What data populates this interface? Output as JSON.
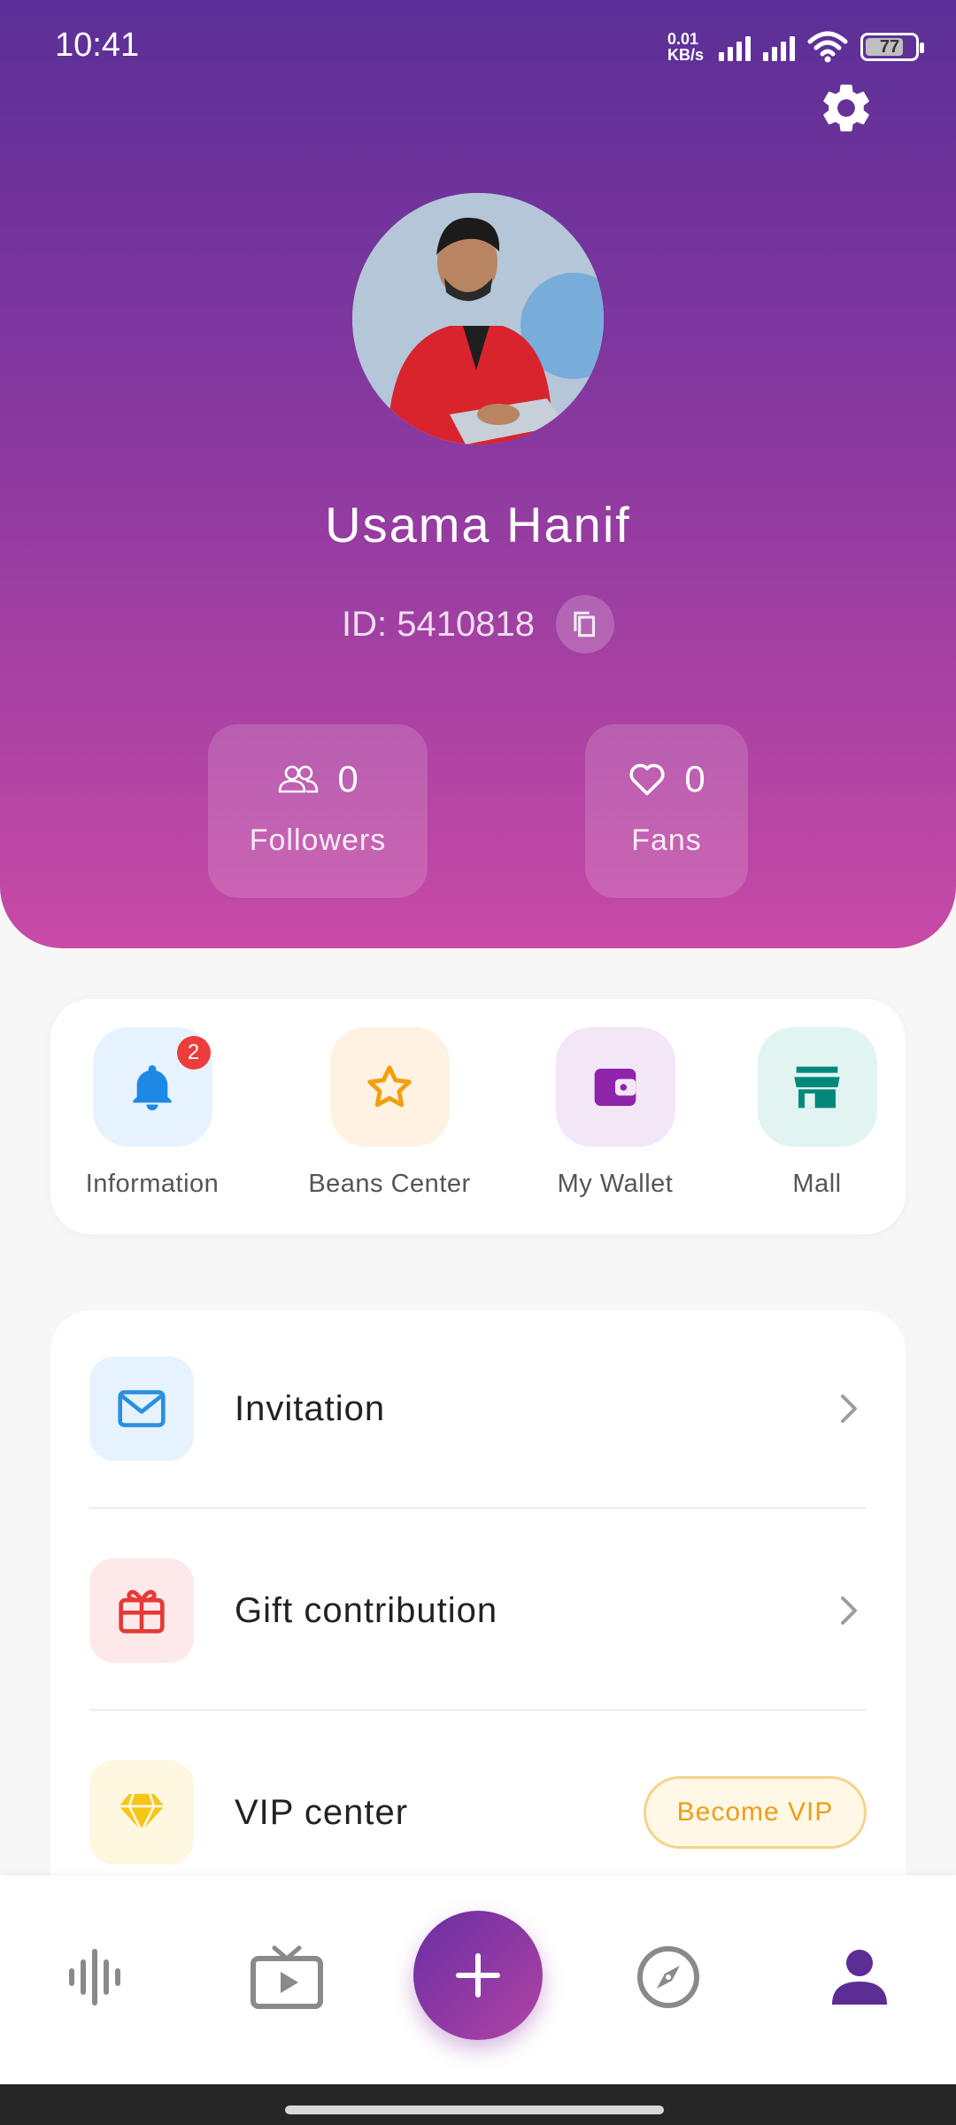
{
  "status_bar": {
    "time": "10:41",
    "net_speed_value": "0.01",
    "net_speed_unit": "KB/s",
    "battery": "77",
    "battery_level": 0.77
  },
  "profile": {
    "name": "Usama Hanif",
    "id_text": "ID: 5410818"
  },
  "stats": [
    {
      "count": "0",
      "label": "Followers",
      "icon": "people-icon"
    },
    {
      "count": "0",
      "label": "Fans",
      "icon": "heart-icon"
    }
  ],
  "quick_actions": [
    {
      "label": "Information",
      "icon": "bell-icon",
      "color": "#1e88e5",
      "bg": "#e6f3ff",
      "badge": "2"
    },
    {
      "label": "Beans Center",
      "icon": "star-icon",
      "color": "#f59e0b",
      "bg": "#fff2e3"
    },
    {
      "label": "My Wallet",
      "icon": "wallet-icon",
      "color": "#8e24aa",
      "bg": "#f3e6f7"
    },
    {
      "label": "Mall",
      "icon": "store-icon",
      "color": "#00897b",
      "bg": "#e2f4f1"
    }
  ],
  "menu": [
    {
      "label": "Invitation",
      "icon": "mail-icon",
      "color": "#2a8fe0",
      "bg": "#e6f3ff"
    },
    {
      "label": "Gift contribution",
      "icon": "gift-icon",
      "color": "#e53935",
      "bg": "#fde9ea"
    },
    {
      "label": "VIP center",
      "icon": "diamond-icon",
      "color": "#f5c518",
      "bg": "#fff8e1",
      "action_label": "Become VIP"
    }
  ],
  "bottom_nav": [
    {
      "name": "audio-wave-icon",
      "active": false
    },
    {
      "name": "tv-icon",
      "active": false
    },
    {
      "name": "add-icon",
      "active": false
    },
    {
      "name": "compass-icon",
      "active": false
    },
    {
      "name": "person-icon",
      "active": true
    }
  ],
  "colors": {
    "header_gradient_top": "#5a2f97",
    "header_gradient_bottom": "#c84aa6",
    "nav_active": "#5b2d95",
    "nav_inactive": "#8a8a8a"
  }
}
